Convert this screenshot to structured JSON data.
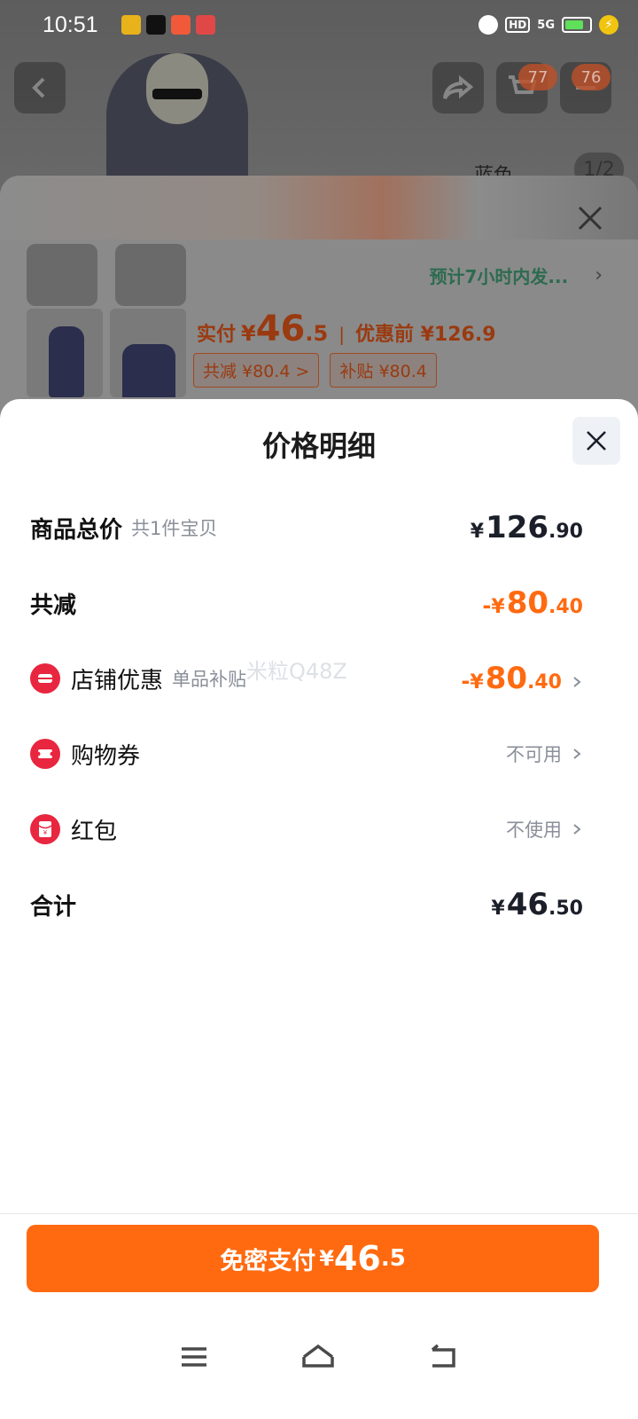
{
  "status_bar": {
    "time": "10:51",
    "icons": [
      "app-icon-1",
      "douyin-icon",
      "app-icon-3",
      "app-icon-4",
      "alarm-icon",
      "hd-icon",
      "5g-signal-icon",
      "battery-icon",
      "charging-icon"
    ],
    "hd_label": "HD",
    "signal_label": "5G"
  },
  "background_page": {
    "product_title_fragment": "蓝色",
    "image_counter": "1/2",
    "cart_badge": "77",
    "message_badge": "76",
    "order_summary": {
      "shipping_note": "预计7小时内发...",
      "pay_label": "实付",
      "pay_yuan": "¥",
      "pay_int": "46",
      "pay_dec": ".5",
      "before_label": "优惠前 ¥126.9",
      "chip_reduce": "共减 ¥80.4 >",
      "chip_subsidy": "补贴 ¥80.4"
    }
  },
  "price_detail": {
    "title": "价格明细",
    "rows": [
      {
        "label": "商品总价",
        "sub": "共1件宝贝",
        "sign": "",
        "yuan": "¥",
        "int": "126",
        "dec": ".90"
      },
      {
        "label": "共减",
        "sub": "",
        "sign": "-",
        "yuan": "¥",
        "int": "80",
        "dec": ".40"
      },
      {
        "label": "店铺优惠",
        "sub": "单品补贴",
        "sign": "-",
        "yuan": "¥",
        "int": "80",
        "dec": ".40"
      },
      {
        "label": "购物券",
        "status": "不可用"
      },
      {
        "label": "红包",
        "status": "不使用"
      },
      {
        "label": "合计",
        "sub": "",
        "sign": "",
        "yuan": "¥",
        "int": "46",
        "dec": ".50"
      }
    ],
    "watermark": "米粒Q48Z"
  },
  "pay_button": {
    "label": "免密支付",
    "yuan": "¥",
    "int": "46",
    "dec": ".5"
  },
  "colors": {
    "accent": "#ff6a10",
    "icon_red": "#e8263f",
    "muted_text": "#8a8f99"
  }
}
